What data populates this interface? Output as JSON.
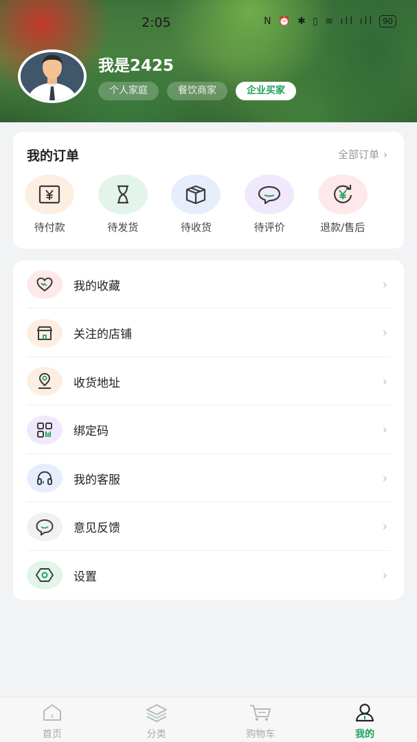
{
  "status_bar": {
    "time": "2:05",
    "icons": "N ⏰ ✱ ▯ ≋ ıll ıll",
    "battery": "90"
  },
  "profile": {
    "username": "我是2425",
    "tags": [
      {
        "label": "个人家庭",
        "active": false
      },
      {
        "label": "餐饮商家",
        "active": false
      },
      {
        "label": "企业买家",
        "active": true
      }
    ]
  },
  "orders": {
    "title": "我的订单",
    "all_label": "全部订单",
    "items": [
      {
        "label": "待付款",
        "icon": "yuan-icon",
        "bg": "#fdeee2",
        "color": "#3a3a3a"
      },
      {
        "label": "待发货",
        "icon": "hourglass-icon",
        "bg": "#e3f4ea",
        "color": "#3a3a3a"
      },
      {
        "label": "待收货",
        "icon": "box-icon",
        "bg": "#e6eefc",
        "color": "#3a3a3a"
      },
      {
        "label": "待评价",
        "icon": "chat-bubble-icon",
        "bg": "#efe9fb",
        "color": "#3a3a3a"
      },
      {
        "label": "退款/售后",
        "icon": "refund-icon",
        "bg": "#fde8ea",
        "color": "#1fa15a"
      }
    ]
  },
  "menu": {
    "items": [
      {
        "label": "我的收藏",
        "icon": "heart-icon",
        "bg": "#fde8ea"
      },
      {
        "label": "关注的店铺",
        "icon": "store-icon",
        "bg": "#fdeee2"
      },
      {
        "label": "收货地址",
        "icon": "location-pin-icon",
        "bg": "#fdeee2"
      },
      {
        "label": "绑定码",
        "icon": "qr-code-icon",
        "bg": "#efe9fb"
      },
      {
        "label": "我的客服",
        "icon": "headset-icon",
        "bg": "#e6eefc"
      },
      {
        "label": "意见反馈",
        "icon": "feedback-icon",
        "bg": "#f1f1f1"
      },
      {
        "label": "设置",
        "icon": "settings-icon",
        "bg": "#e3f4ea"
      }
    ]
  },
  "tabbar": {
    "tabs": [
      {
        "label": "首页",
        "icon": "home-icon",
        "active": false
      },
      {
        "label": "分类",
        "icon": "category-icon",
        "active": false
      },
      {
        "label": "购物车",
        "icon": "cart-icon",
        "active": false
      },
      {
        "label": "我的",
        "icon": "user-icon",
        "active": true
      }
    ]
  },
  "colors": {
    "accent": "#1fa15a",
    "background": "#f2f3f5"
  }
}
